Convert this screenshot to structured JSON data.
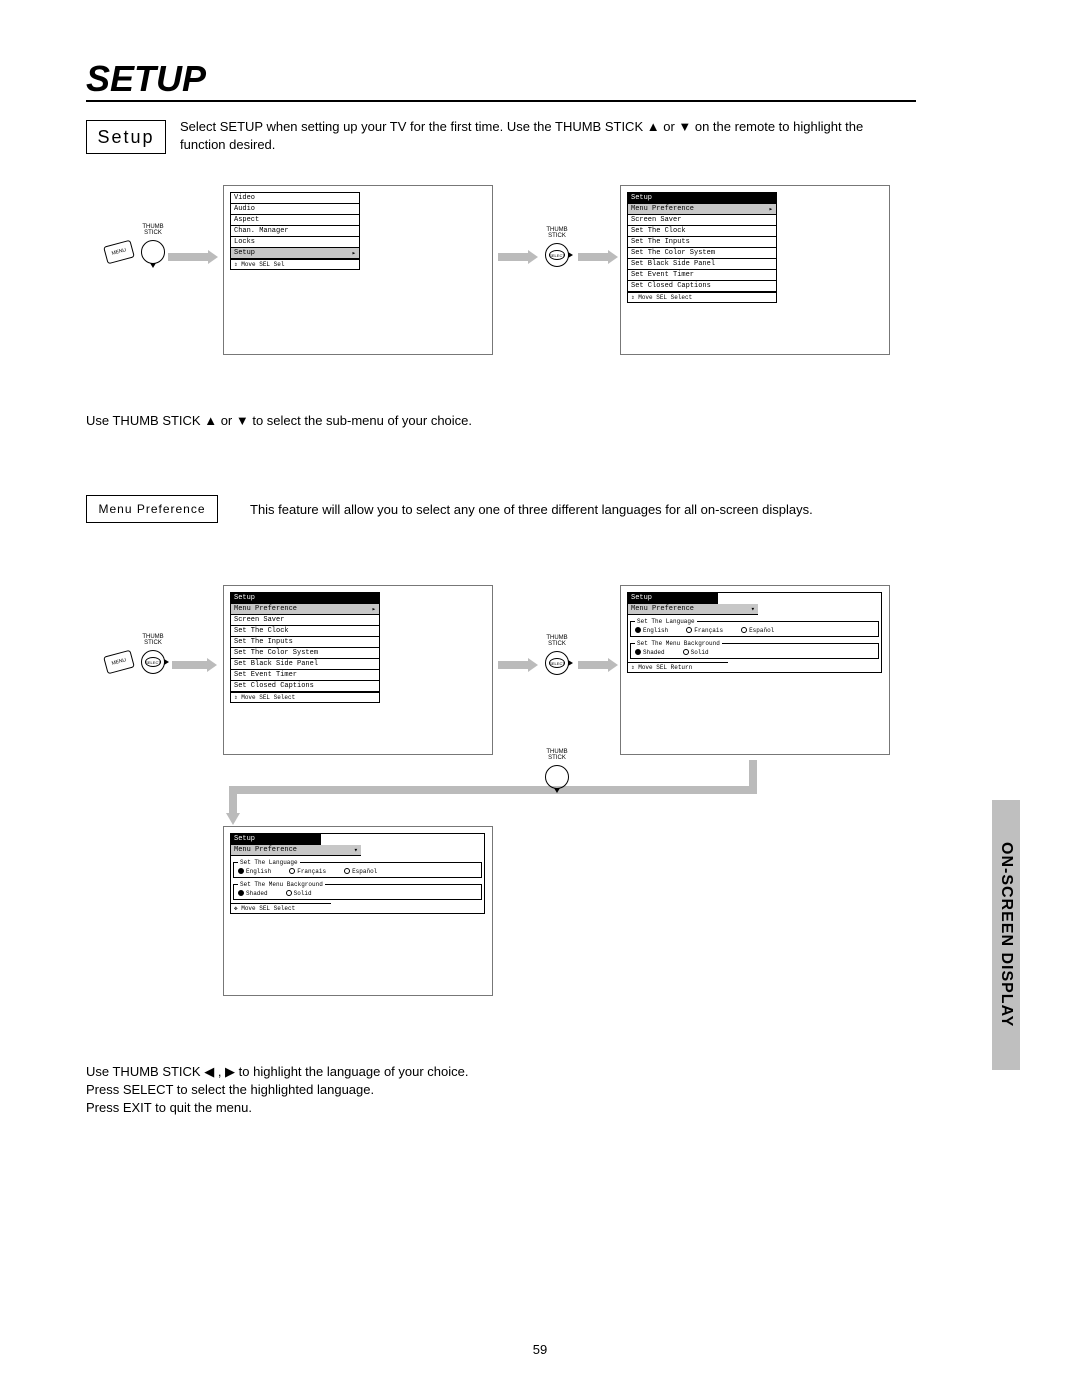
{
  "page_title": "SETUP",
  "setup_label": "Setup",
  "intro": "Select SETUP when setting up your TV for the first time.  Use the THUMB STICK ▲ or ▼ on the remote to highlight the function desired.",
  "submenu_text": "Use THUMB STICK ▲ or ▼ to select the sub-menu of your choice.",
  "menu_pref_label": "Menu Preference",
  "menu_pref_desc": "This feature will allow you to select any one of three different languages for all on-screen displays.",
  "bottom_instructions": "Use THUMB STICK ◀ , ▶ to highlight the language of your choice.\nPress SELECT to select the highlighted language.\nPress EXIT to quit the menu.",
  "side_tab": "ON-SCREEN DISPLAY",
  "page_number": "59",
  "thumb_label": "THUMB\nSTICK",
  "menu_btn": "MENU",
  "select_btn": "SELECT",
  "osd": {
    "main_menu": [
      "Video",
      "Audio",
      "Aspect",
      "Chan. Manager",
      "Locks",
      "Setup"
    ],
    "main_footer": "⇕ Move  SEL Sel",
    "setup_title": "Setup",
    "setup_items": [
      "Menu Preference",
      "Screen Saver",
      "Set The Clock",
      "Set The Inputs",
      "Set The Color System",
      "Set Black Side Panel",
      "Set Event Timer",
      "Set Closed Captions"
    ],
    "setup_footer": "⇕ Move  SEL Select",
    "lang_title": "Set The Language",
    "lang_opts": [
      "English",
      "Français",
      "Español"
    ],
    "bg_title": "Set The Menu Background",
    "bg_opts": [
      "Shaded",
      "Solid"
    ],
    "pref_footer_return": "⇕ Move  SEL Return",
    "pref_footer_select": "✥ Move  SEL Select"
  }
}
